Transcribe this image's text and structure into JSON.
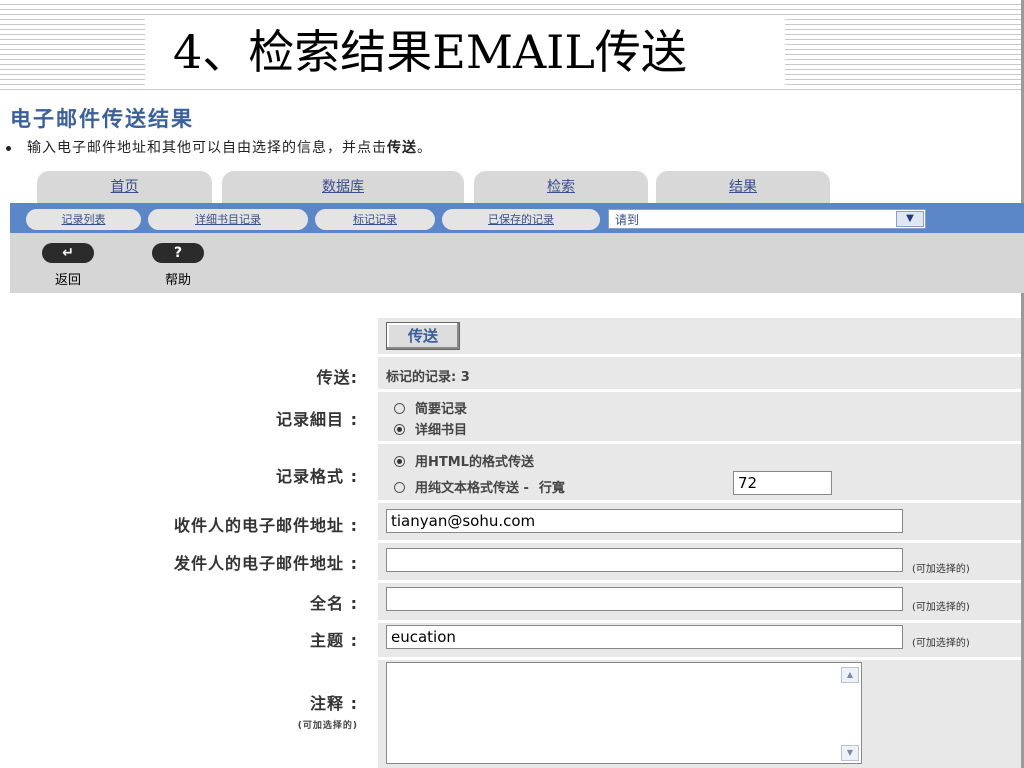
{
  "slide": {
    "title": "4、检索结果EMAIL传送"
  },
  "heading": "电子邮件传送结果",
  "instruction": {
    "prefix": "输入电子邮件地址和其他可以自由选择的信息，并点击",
    "bold": "传送",
    "suffix": "。"
  },
  "tabs": [
    {
      "label": "首页"
    },
    {
      "label": "数据库"
    },
    {
      "label": "检索"
    },
    {
      "label": "结果"
    }
  ],
  "subnav": [
    {
      "label": "记录列表"
    },
    {
      "label": "详细书目记录"
    },
    {
      "label": "标记记录"
    },
    {
      "label": "已保存的记录"
    }
  ],
  "goto": {
    "value": "请到"
  },
  "toolbar": {
    "back": {
      "glyph": "↵",
      "label": "返回",
      "icon": "back-arrow-icon"
    },
    "help": {
      "glyph": "?",
      "label": "帮助",
      "icon": "question-icon"
    }
  },
  "form": {
    "send_button": "传送",
    "send_label": "传送:",
    "send_value": "标记的记录: 3",
    "detail_label": "记录細目 :",
    "detail_options": [
      {
        "label": "简要记录",
        "selected": false
      },
      {
        "label": "详细书目",
        "selected": true
      }
    ],
    "format_label": "记录格式 :",
    "format_options": [
      {
        "label": "用HTML的格式传送",
        "selected": true
      },
      {
        "label": "用纯文本格式传送 -",
        "selected": false
      }
    ],
    "line_width_label": "行寬",
    "line_width_value": "72",
    "recipient_label": "收件人的电子邮件地址 :",
    "recipient_value": "tianyan@sohu.com",
    "sender_label": "发件人的电子邮件地址 :",
    "sender_value": "",
    "fullname_label": "全名 :",
    "fullname_value": "",
    "subject_label": "主题 :",
    "subject_value": "eucation",
    "optional_note": "(可加选择的)",
    "notes_label": "注释 :",
    "notes_optional": "(可加选择的)",
    "notes_value": ""
  }
}
